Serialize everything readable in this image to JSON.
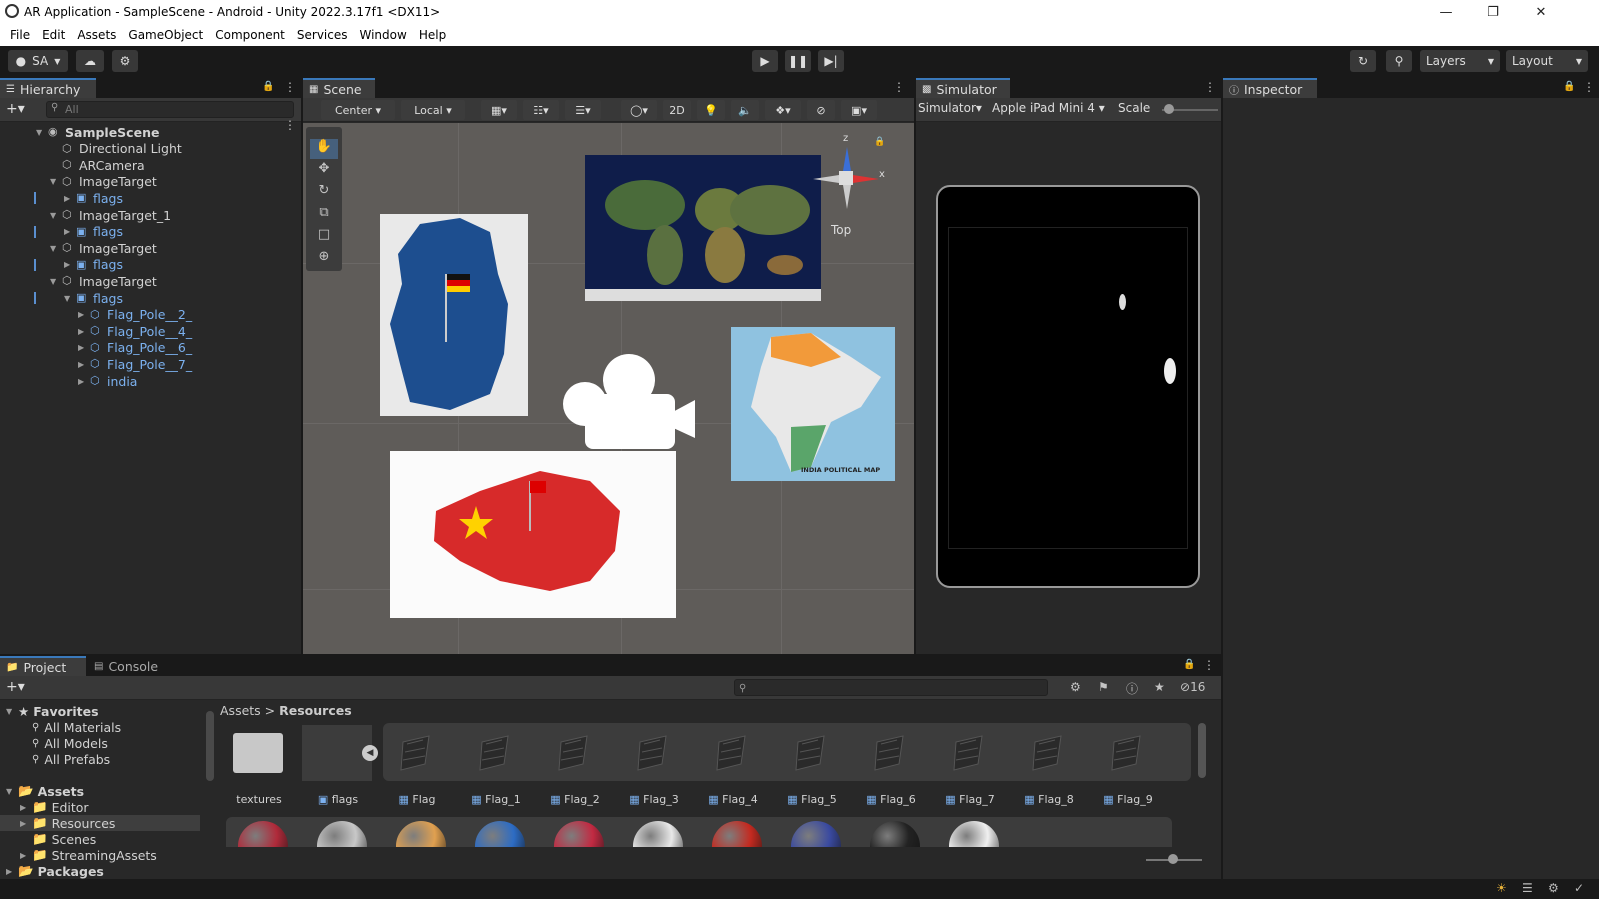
{
  "window": {
    "title": "AR Application - SampleScene - Android - Unity 2022.3.17f1 <DX11>"
  },
  "menu": [
    "File",
    "Edit",
    "Assets",
    "GameObject",
    "Component",
    "Services",
    "Window",
    "Help"
  ],
  "toolbar": {
    "account": "SA",
    "layers": "Layers",
    "layout": "Layout"
  },
  "hierarchy": {
    "tab": "Hierarchy",
    "search_placeholder": "All",
    "items": [
      {
        "label": "SampleScene",
        "indent": 0,
        "style": "scene",
        "arrow": "▼"
      },
      {
        "label": "Directional Light",
        "indent": 1,
        "style": "normal",
        "arrow": ""
      },
      {
        "label": "ARCamera",
        "indent": 1,
        "style": "normal",
        "arrow": ""
      },
      {
        "label": "ImageTarget",
        "indent": 1,
        "style": "normal",
        "arrow": "▼"
      },
      {
        "label": "flags",
        "indent": 2,
        "style": "blue",
        "arrow": "▶"
      },
      {
        "label": "ImageTarget_1",
        "indent": 1,
        "style": "normal",
        "arrow": "▼"
      },
      {
        "label": "flags",
        "indent": 2,
        "style": "blue",
        "arrow": "▶"
      },
      {
        "label": "ImageTarget",
        "indent": 1,
        "style": "normal",
        "arrow": "▼"
      },
      {
        "label": "flags",
        "indent": 2,
        "style": "blue",
        "arrow": "▶"
      },
      {
        "label": "ImageTarget",
        "indent": 1,
        "style": "normal",
        "arrow": "▼"
      },
      {
        "label": "flags",
        "indent": 2,
        "style": "blue",
        "arrow": "▼"
      },
      {
        "label": "Flag_Pole__2_",
        "indent": 3,
        "style": "blue",
        "arrow": "▶"
      },
      {
        "label": "Flag_Pole__4_",
        "indent": 3,
        "style": "blue",
        "arrow": "▶"
      },
      {
        "label": "Flag_Pole__6_",
        "indent": 3,
        "style": "blue",
        "arrow": "▶"
      },
      {
        "label": "Flag_Pole__7_",
        "indent": 3,
        "style": "blue",
        "arrow": "▶"
      },
      {
        "label": "india",
        "indent": 3,
        "style": "blue",
        "arrow": "▶"
      }
    ]
  },
  "scene": {
    "tab": "Scene",
    "pivot": "Center",
    "space": "Local",
    "mode2d": "2D",
    "gizmo_label": "Top",
    "gizmo_axes": [
      "z",
      "x"
    ],
    "map_caption": "INDIA POLITICAL MAP"
  },
  "simulator": {
    "tab": "Simulator",
    "mode": "Simulator",
    "device": "Apple iPad Mini 4",
    "scale_label": "Scale"
  },
  "inspector": {
    "tab": "Inspector"
  },
  "project": {
    "tabs": [
      "Project",
      "Console"
    ],
    "hidden_count": "16",
    "breadcrumb": [
      "Assets",
      "Resources"
    ],
    "favorites_label": "Favorites",
    "favorites": [
      "All Materials",
      "All Models",
      "All Prefabs"
    ],
    "assets_label": "Assets",
    "asset_folders": [
      "Editor",
      "Resources",
      "Scenes",
      "StreamingAssets"
    ],
    "packages_label": "Packages",
    "grid_items": [
      "textures",
      "flags",
      "Flag",
      "Flag_1",
      "Flag_2",
      "Flag_3",
      "Flag_4",
      "Flag_5",
      "Flag_6",
      "Flag_7",
      "Flag_8",
      "Flag_9"
    ]
  },
  "colors": {
    "accent": "#3a79bb",
    "panel": "#282828",
    "scene_bg": "#5f5c59",
    "blue_text": "#7cb1ef"
  }
}
